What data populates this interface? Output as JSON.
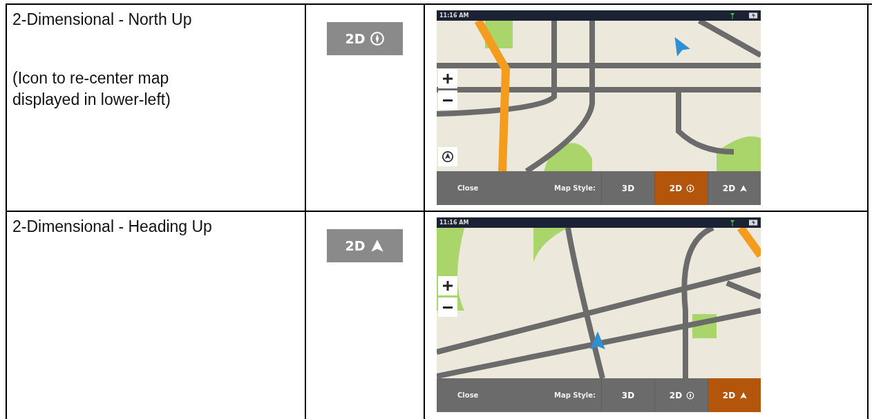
{
  "rows": [
    {
      "mode_name": "2-Dimensional - North Up",
      "note": "(Icon to re-center map displayed in lower-left)",
      "icon_button": {
        "label": "2D",
        "kind": "compass"
      },
      "screenshot": {
        "time": "11:16 AM",
        "recenter": true,
        "close": "Close",
        "map_style_label": "Map Style:",
        "styles": [
          {
            "label": "3D",
            "kind": "plain",
            "selected": false
          },
          {
            "label": "2D",
            "kind": "compass",
            "selected": true
          },
          {
            "label": "2D",
            "kind": "arrow",
            "selected": false
          }
        ]
      }
    },
    {
      "mode_name": "2-Dimensional - Heading Up",
      "icon_button": {
        "label": "2D",
        "kind": "arrow"
      },
      "screenshot": {
        "time": "11:16 AM",
        "recenter": false,
        "close": "Close",
        "map_style_label": "Map Style:",
        "styles": [
          {
            "label": "3D",
            "kind": "plain",
            "selected": false
          },
          {
            "label": "2D",
            "kind": "compass",
            "selected": false
          },
          {
            "label": "2D",
            "kind": "arrow",
            "selected": true
          }
        ]
      }
    }
  ]
}
